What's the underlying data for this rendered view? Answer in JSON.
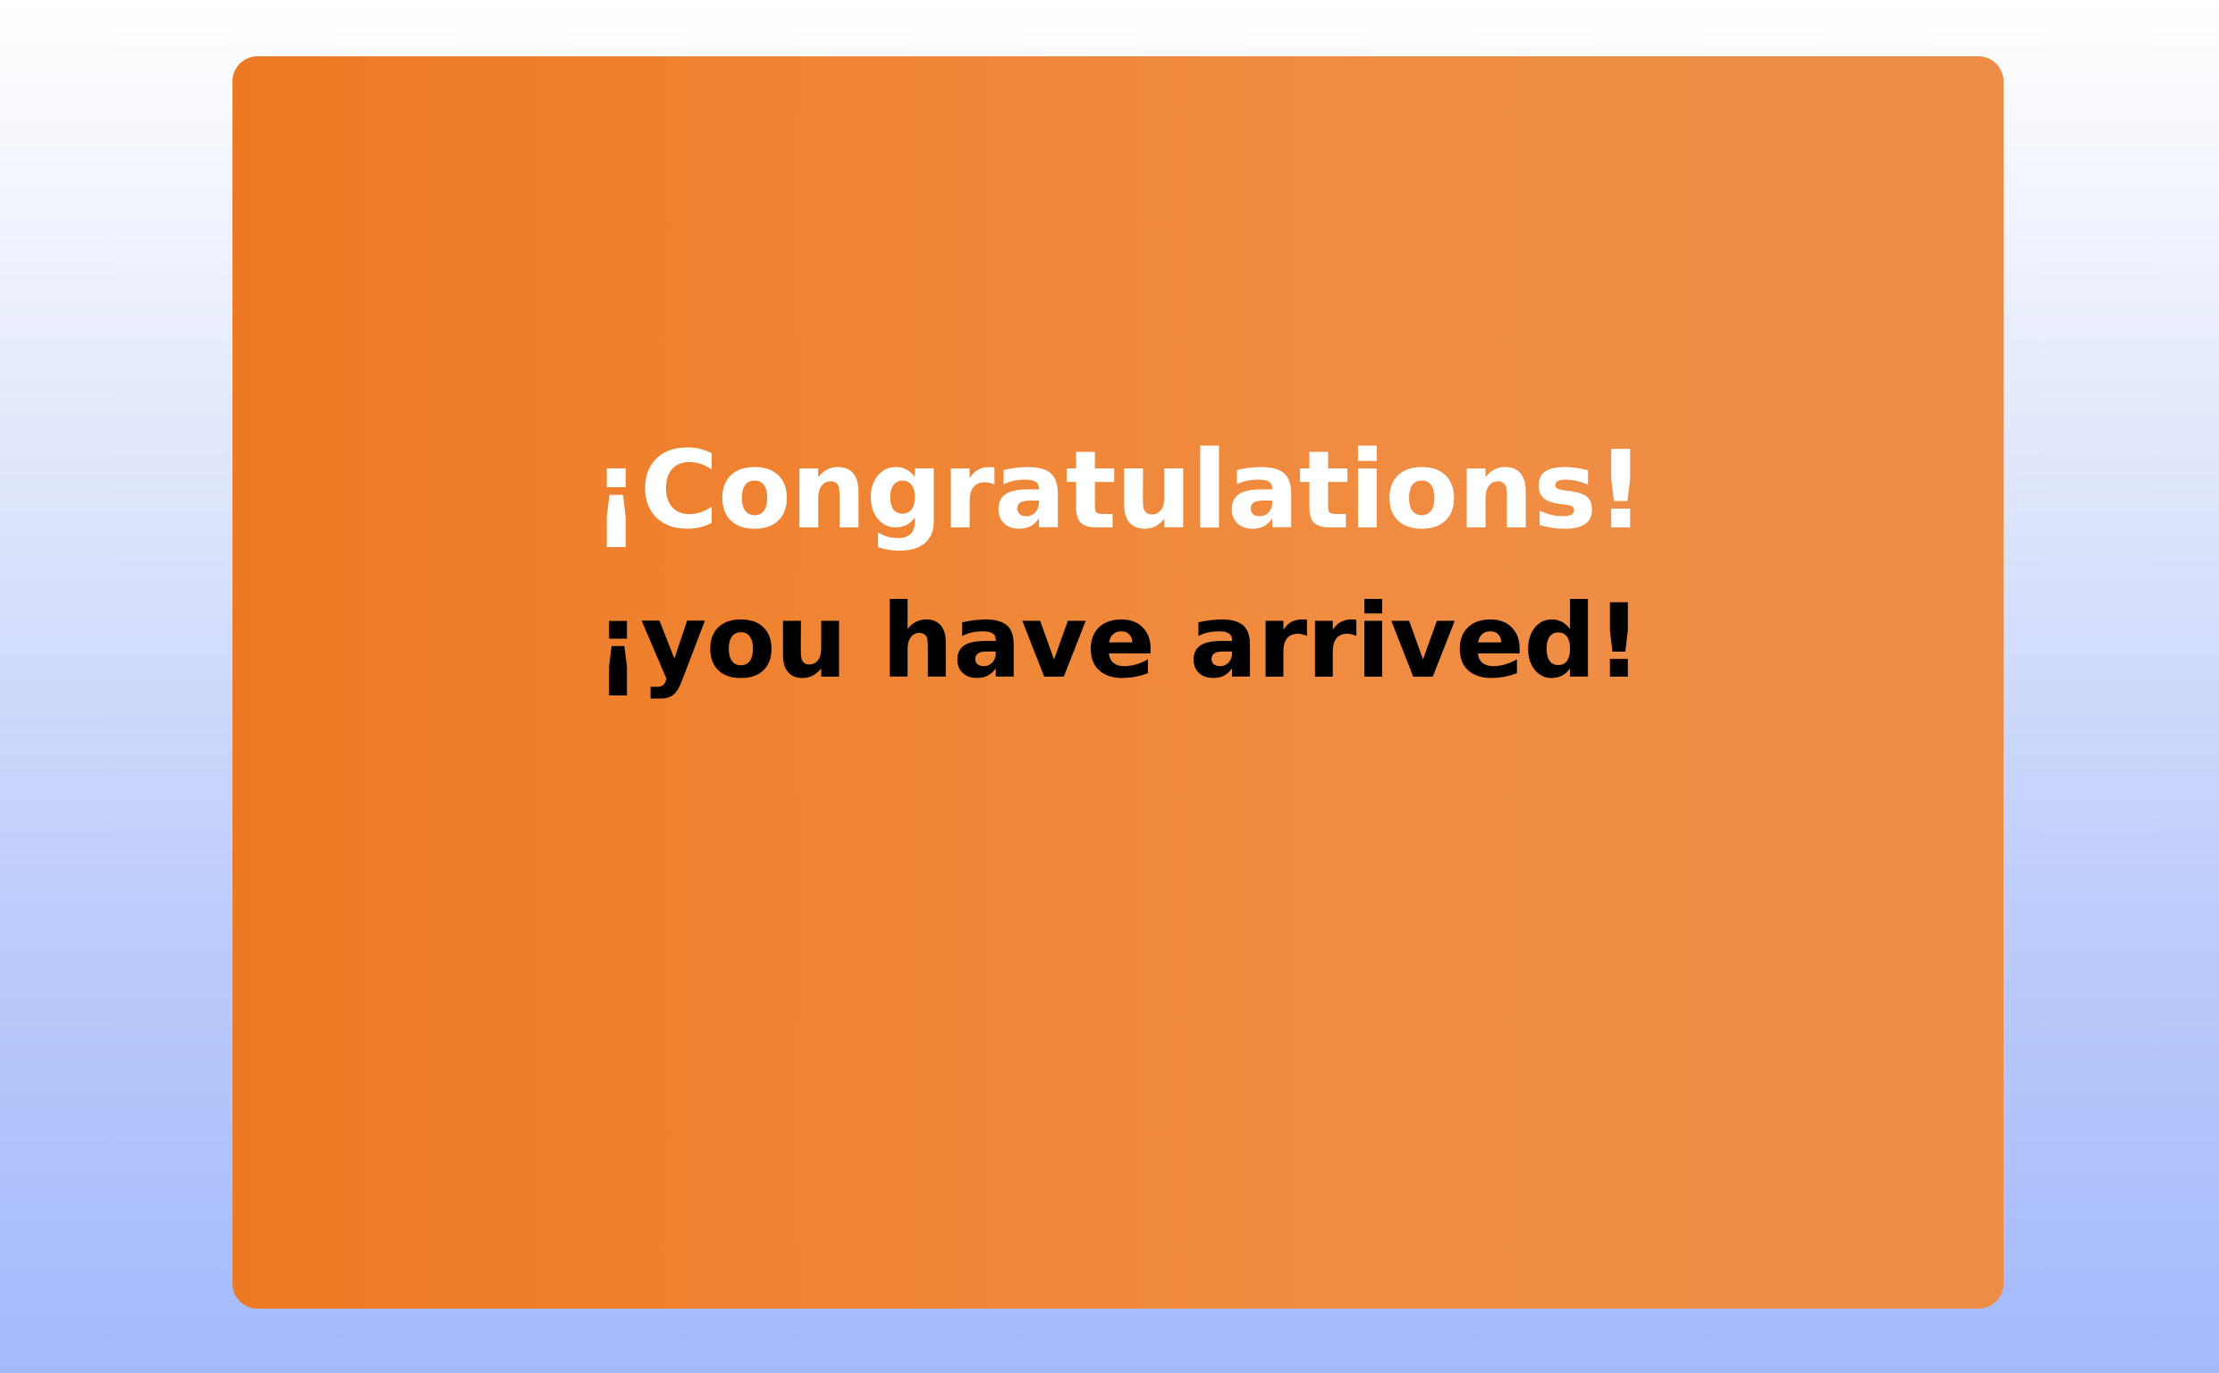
{
  "card": {
    "headline": "¡Congratulations!",
    "subline": "¡you have arrived!"
  },
  "colors": {
    "background_top": "#ffffff",
    "background_bottom": "#a3b9fb",
    "card_left": "#ee7924",
    "card_right": "#ec8c47",
    "headline_text": "#ffffff",
    "subline_text": "#000000"
  }
}
